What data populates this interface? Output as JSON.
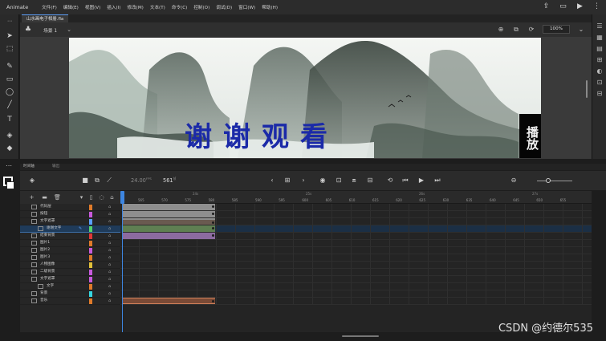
{
  "app": {
    "title": "Animate"
  },
  "menu": [
    "文件(F)",
    "编辑(E)",
    "视图(V)",
    "插入(I)",
    "修改(M)",
    "文本(T)",
    "命令(C)",
    "控制(O)",
    "调试(D)",
    "窗口(W)",
    "帮助(H)"
  ],
  "document": {
    "tab_label": "山水画电子相册.fla"
  },
  "scene": {
    "label": "场景 1",
    "zoom": "100%"
  },
  "stage": {
    "thanks_text": "谢谢观看",
    "play_button_label": "播放"
  },
  "timeline": {
    "tab_label": "时间轴",
    "tab2_label": "输出",
    "fps": "24.00",
    "fps_unit": "FPS",
    "current_frame": "561",
    "frame_unit": "帧",
    "ruler_seconds": [
      "24s",
      "25s",
      "26s",
      "27s"
    ],
    "ruler_numbers": [
      "565",
      "570",
      "575",
      "580",
      "585",
      "590",
      "595",
      "600",
      "605",
      "610",
      "615",
      "620",
      "625",
      "630",
      "635",
      "640",
      "645",
      "650",
      "655"
    ]
  },
  "layers": [
    {
      "name": "代码层",
      "color": "#e07b2a",
      "indent": false,
      "selected": false,
      "span": "gray"
    },
    {
      "name": "按钮",
      "color": "#c85adc",
      "indent": false,
      "selected": false,
      "span": "gray"
    },
    {
      "name": "文字遮罩",
      "color": "#5aa0ff",
      "indent": false,
      "selected": false,
      "span": "orange"
    },
    {
      "name": "谢谢文字",
      "color": "#54d46a",
      "indent": true,
      "selected": true,
      "span": "green"
    },
    {
      "name": "结束背景",
      "color": "#e03838",
      "indent": false,
      "selected": false,
      "span": "purple"
    },
    {
      "name": "图片1",
      "color": "#e07b2a",
      "indent": false,
      "selected": false,
      "span": "none"
    },
    {
      "name": "图片2",
      "color": "#c85adc",
      "indent": false,
      "selected": false,
      "span": "none"
    },
    {
      "name": "图片3",
      "color": "#e07b2a",
      "indent": false,
      "selected": false,
      "span": "none"
    },
    {
      "name": "人物图像",
      "color": "#e0c03a",
      "indent": false,
      "selected": false,
      "span": "none"
    },
    {
      "name": "二级背景",
      "color": "#c85adc",
      "indent": false,
      "selected": false,
      "span": "none"
    },
    {
      "name": "文字遮罩",
      "color": "#c85adc",
      "indent": false,
      "selected": false,
      "span": "none"
    },
    {
      "name": "文字",
      "color": "#e07b2a",
      "indent": true,
      "selected": false,
      "span": "none"
    },
    {
      "name": "背景",
      "color": "#36d6e0",
      "indent": false,
      "selected": false,
      "span": "none"
    },
    {
      "name": "音乐",
      "color": "#e07b2a",
      "indent": false,
      "selected": false,
      "span": "audio"
    }
  ],
  "watermark": "CSDN @约德尔535"
}
